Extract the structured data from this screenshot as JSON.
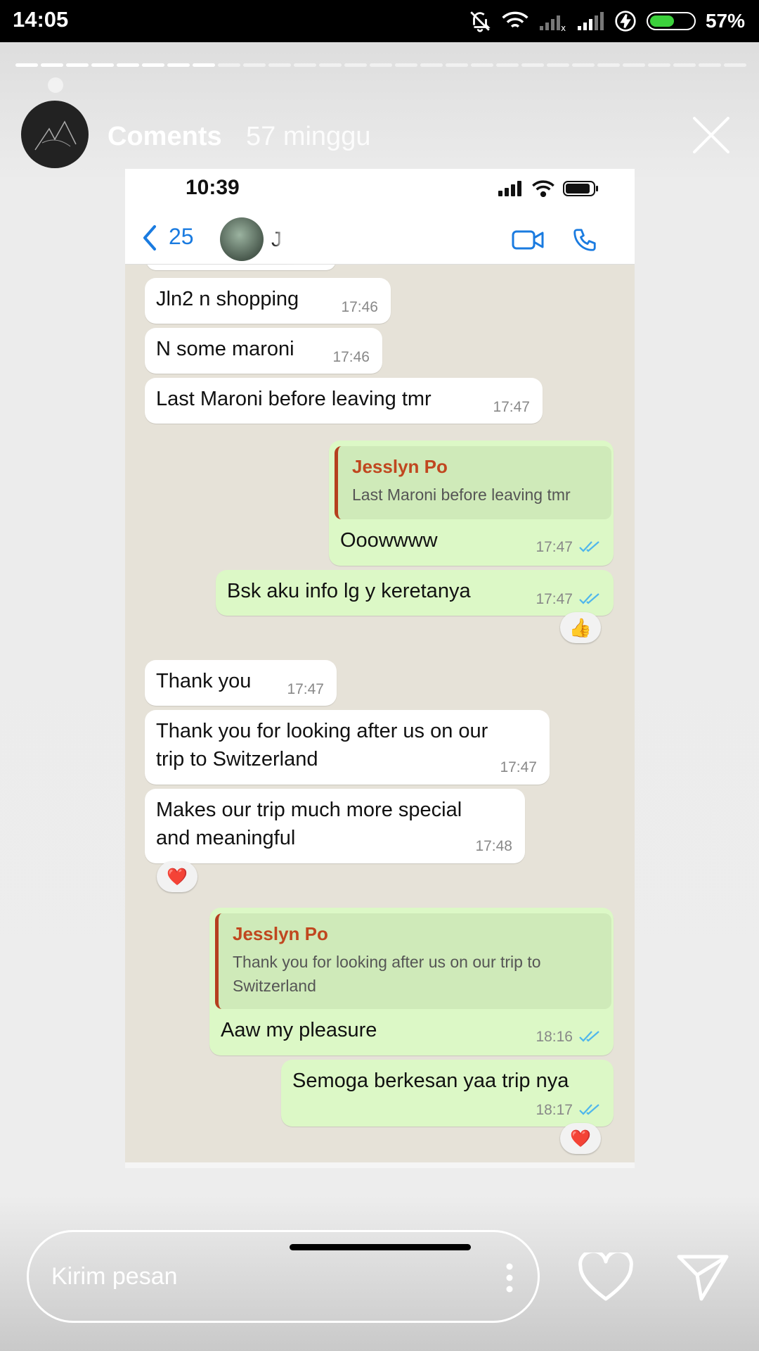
{
  "status_bar": {
    "time": "14:05",
    "battery": "57%"
  },
  "story": {
    "username": "Coments",
    "age": "57 minggu",
    "segments_total": 29,
    "segments_done": 8,
    "reply_placeholder": "Kirim pesan"
  },
  "screenshot": {
    "ios_time": "10:39",
    "back_count": "25",
    "contact_initial": "J",
    "messages": [
      {
        "dir": "in",
        "text": "Jln2 n shopping",
        "time": "17:46"
      },
      {
        "dir": "in",
        "text": "N some maroni",
        "time": "17:46"
      },
      {
        "dir": "in",
        "text": "Last Maroni before leaving tmr",
        "time": "17:47"
      },
      {
        "dir": "out",
        "quote_name": "Jesslyn Po",
        "quote_text": "Last Maroni before leaving tmr",
        "text": "Ooowwww",
        "time": "17:47"
      },
      {
        "dir": "out",
        "text": "Bsk aku info lg y keretanya",
        "time": "17:47",
        "reaction": "👍"
      },
      {
        "dir": "in",
        "text": "Thank you",
        "time": "17:47"
      },
      {
        "dir": "in",
        "text_lines": [
          "Thank you for looking after us on our",
          "trip to Switzerland"
        ],
        "time": "17:47"
      },
      {
        "dir": "in",
        "text_lines": [
          "Makes our trip much more special",
          "and meaningful"
        ],
        "time": "17:48",
        "reaction": "❤️"
      },
      {
        "dir": "out",
        "quote_name": "Jesslyn Po",
        "quote_lines": [
          "Thank you for looking after us on our trip to",
          "Switzerland"
        ],
        "text": "Aaw my pleasure",
        "time": "18:16"
      },
      {
        "dir": "out",
        "text": "Semoga berkesan yaa trip nya",
        "time": "18:17",
        "reaction": "❤️"
      }
    ]
  },
  "colors": {
    "incoming_bubble": "#ffffff",
    "outgoing_bubble": "#dcf8c6",
    "quote_name": "#c0471f",
    "ios_blue": "#1a7be0",
    "read_ticks": "#4fb6ec"
  },
  "icons": [
    "mute-bell-icon",
    "wifi-icon",
    "signal-icon",
    "charging-icon",
    "battery-icon",
    "close-icon",
    "back-chevron-icon",
    "video-call-icon",
    "phone-icon",
    "plus-icon",
    "sticker-icon",
    "camera-icon",
    "mic-icon",
    "more-icon",
    "heart-icon",
    "send-icon"
  ]
}
